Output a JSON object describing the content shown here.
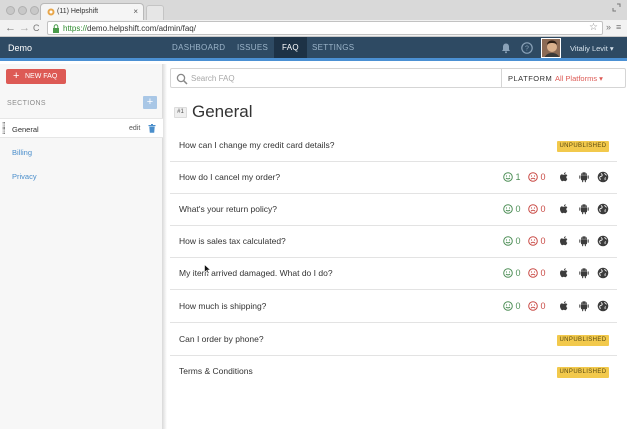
{
  "browser": {
    "tab_title": "(11) Helpshift",
    "tab_close": "×",
    "url_prefix": "https://",
    "url_rest": "demo.helpshift.com/admin/faq/",
    "back": "←",
    "forward": "→",
    "reload": "C",
    "more": "»",
    "menu": "≡"
  },
  "app": {
    "name": "Demo",
    "nav": [
      "DASHBOARD",
      "ISSUES",
      "FAQ",
      "SETTINGS"
    ],
    "active_nav": "FAQ",
    "user_name": "Vitaliy Levit ▾"
  },
  "sidebar": {
    "new_faq_plus": "+",
    "new_faq_label": "NEW FAQ",
    "sections_label": "SECTIONS",
    "add_section": "+",
    "items": [
      {
        "label": "General",
        "active": true,
        "edit": "edit"
      },
      {
        "label": "Billing",
        "active": false
      },
      {
        "label": "Privacy",
        "active": false
      }
    ]
  },
  "search": {
    "placeholder": "Search FAQ",
    "platform_label": "PLATFORM",
    "platform_value": "All Platforms ▾"
  },
  "section": {
    "number": "#1",
    "title": "General"
  },
  "faqs": [
    {
      "question": "How can I change my credit card details?",
      "badge": "UNPUBLISHED"
    },
    {
      "question": "How do I cancel my order?",
      "likes": "1",
      "dislikes": "0"
    },
    {
      "question": "What's your return policy?",
      "likes": "0",
      "dislikes": "0"
    },
    {
      "question": "How is sales tax calculated?",
      "likes": "0",
      "dislikes": "0"
    },
    {
      "question": "My item arrived damaged. What do I do?",
      "likes": "0",
      "dislikes": "0"
    },
    {
      "question": "How much is shipping?",
      "likes": "0",
      "dislikes": "0"
    },
    {
      "question": "Can I order by phone?",
      "badge": "UNPUBLISHED"
    },
    {
      "question": "Terms & Conditions",
      "badge": "UNPUBLISHED"
    }
  ],
  "colors": {
    "header": "#2e4a63",
    "header_accent": "#4b90d3",
    "new_faq": "#dd5a55",
    "unpublished": "#f2c94c",
    "like": "#4f8f58",
    "dislike": "#c94a45",
    "link": "#4a8ecb"
  },
  "icons": {
    "platform": [
      "apple-icon",
      "android-icon",
      "globe-icon"
    ],
    "like": "smile-icon",
    "dislike": "frown-icon"
  }
}
